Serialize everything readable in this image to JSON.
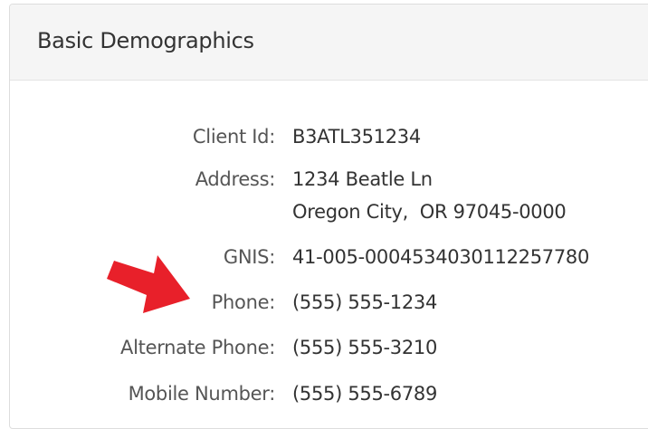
{
  "panel": {
    "title": "Basic Demographics"
  },
  "fields": {
    "client_id": {
      "label": "Client Id:",
      "value": "B3ATL351234"
    },
    "address": {
      "label": "Address:",
      "line1": "1234 Beatle Ln",
      "line2": "Oregon City,  OR 97045-0000"
    },
    "gnis": {
      "label": "GNIS:",
      "value": "41-005-0004534030112257780"
    },
    "phone": {
      "label": "Phone:",
      "value": "(555) 555-1234"
    },
    "alternate_phone": {
      "label": "Alternate Phone:",
      "value": "(555) 555-3210"
    },
    "mobile_number": {
      "label": "Mobile Number:",
      "value": "(555) 555-6789"
    }
  },
  "annotation": {
    "arrow_icon": "red-arrow-icon",
    "arrow_color": "#e8202a"
  },
  "colors": {
    "heading_bg": "#f5f5f5",
    "border": "#dddddd",
    "label_text": "#555555",
    "value_text": "#333333"
  }
}
